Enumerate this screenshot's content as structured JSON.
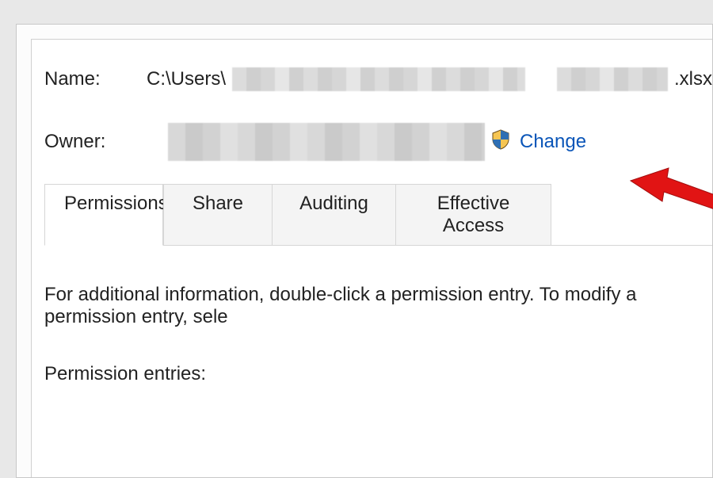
{
  "name_row": {
    "label": "Name:",
    "path_prefix": "C:\\Users\\",
    "path_suffix": ".xlsx"
  },
  "owner_row": {
    "label": "Owner:",
    "change_label": "Change"
  },
  "tabs": {
    "permissions": "Permissions",
    "share": "Share",
    "auditing": "Auditing",
    "effective_access": "Effective Access"
  },
  "info_text": "For additional information, double-click a permission entry. To modify a permission entry, sele",
  "permission_entries_label": "Permission entries:",
  "icons": {
    "shield": "shield-icon",
    "arrow": "annotation-arrow"
  },
  "colors": {
    "link": "#0a55b8",
    "arrow": "#e11414"
  }
}
